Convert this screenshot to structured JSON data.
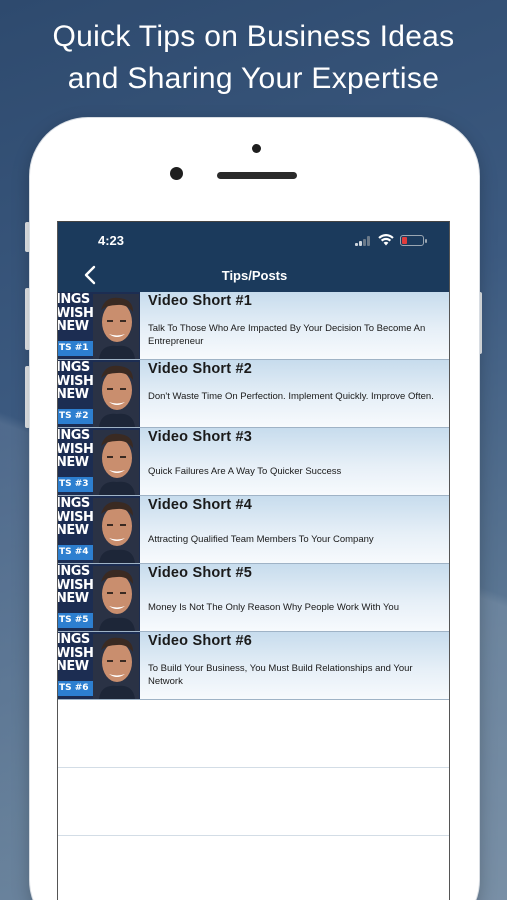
{
  "headline": {
    "line1": "Quick Tips on Business Ideas",
    "line2": "and Sharing Your Expertise"
  },
  "status_bar": {
    "time": "4:23"
  },
  "nav": {
    "title": "Tips/Posts",
    "back_icon": "chevron-left-icon"
  },
  "thumbnail": {
    "line1": "INGS",
    "line2": "WISH",
    "line3": "NEW"
  },
  "posts": [
    {
      "title": "Video Short #1",
      "description": "Talk To Those Who Are Impacted By Your Decision To Become An Entrepreneur",
      "badge": "TS #1"
    },
    {
      "title": "Video Short #2",
      "description": "Don't Waste Time On Perfection. Implement Quickly. Improve Often.",
      "badge": "TS #2"
    },
    {
      "title": "Video Short #3",
      "description": "Quick Failures Are A Way To Quicker Success",
      "badge": "TS #3"
    },
    {
      "title": "Video Short #4",
      "description": "Attracting Qualified Team Members To Your Company",
      "badge": "TS #4"
    },
    {
      "title": "Video Short #5",
      "description": "Money Is Not The Only Reason Why People Work With You",
      "badge": "TS #5"
    },
    {
      "title": "Video Short #6",
      "description": "To Build Your Business, You Must Build Relationships and Your Network",
      "badge": "TS #6"
    }
  ],
  "colors": {
    "nav_background": "#1b3a5c",
    "row_gradient_top": "#c7dced",
    "thumbnail_badge": "#2d7fd0",
    "battery_low": "#e03c3c"
  }
}
